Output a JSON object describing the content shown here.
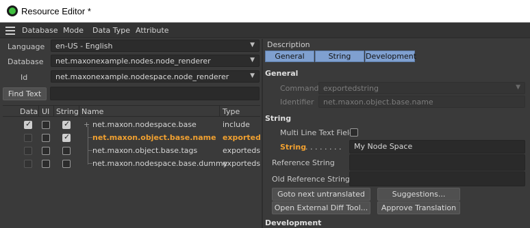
{
  "window": {
    "title": "Resource Editor *"
  },
  "menu": [
    "Database",
    "Mode",
    "Data Type",
    "Attribute"
  ],
  "left": {
    "language_label": "Language",
    "language_value": "en-US - English",
    "database_label": "Database",
    "database_value": "net.maxonexample.nodes.node_renderer",
    "id_label": "Id",
    "id_value": "net.maxonexample.nodespace.node_renderer",
    "find_button": "Find Text",
    "find_value": ""
  },
  "table": {
    "columns": [
      "Data",
      "UI",
      "String",
      "Name",
      "Type"
    ],
    "rows": [
      {
        "name": "net.maxon.nodespace.base",
        "type": "include",
        "data": true,
        "ui": false,
        "string": true,
        "selected": false,
        "expander": "+"
      },
      {
        "name": "net.maxon.object.base.name",
        "type": "exportedstring",
        "data": false,
        "ui": false,
        "string": true,
        "selected": true,
        "expander": ""
      },
      {
        "name": "net.maxon.object.base.tags",
        "type": "exportedstring",
        "data": false,
        "ui": false,
        "string": false,
        "selected": false,
        "expander": ""
      },
      {
        "name": "net.maxon.nodespace.base.dummy",
        "type": "exportedstring",
        "data": false,
        "ui": false,
        "string": false,
        "selected": false,
        "expander": ""
      }
    ]
  },
  "right": {
    "description_label": "Description",
    "tabs": [
      "General",
      "String",
      "Development"
    ],
    "general_title": "General",
    "command_label": "Command",
    "command_value": "exportedstring",
    "identifier_label": "Identifier",
    "identifier_value": "net.maxon.object.base.name",
    "string_title": "String",
    "multiline_label": "Multi Line Text Field",
    "string_label": "String",
    "string_dots": ". . . . . . . .",
    "string_value": "My Node Space",
    "reference_label": "Reference String",
    "reference_value": "",
    "old_reference_label": "Old Reference String",
    "old_reference_value": "",
    "goto_button": "Goto next untranslated",
    "suggestions_button": "Suggestions...",
    "diff_button": "Open External Diff Tool...",
    "approve_button": "Approve Translation",
    "development_title": "Development"
  },
  "colors": {
    "accent_orange": "#f0a030",
    "tab_blue": "#7fa0d0"
  }
}
